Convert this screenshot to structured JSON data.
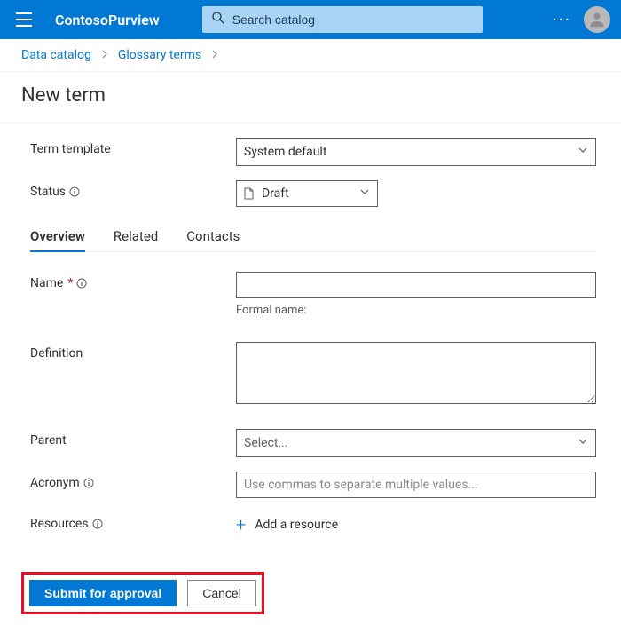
{
  "header": {
    "app_name": "ContosoPurview",
    "search_placeholder": "Search catalog"
  },
  "breadcrumb": {
    "items": [
      {
        "label": "Data catalog"
      },
      {
        "label": "Glossary terms"
      }
    ]
  },
  "page_title": "New term",
  "form": {
    "term_template": {
      "label": "Term template",
      "value": "System default"
    },
    "status": {
      "label": "Status",
      "value": "Draft"
    }
  },
  "tabs": [
    {
      "label": "Overview",
      "active": true
    },
    {
      "label": "Related",
      "active": false
    },
    {
      "label": "Contacts",
      "active": false
    }
  ],
  "fields": {
    "name": {
      "label": "Name",
      "required_mark": "*",
      "value": "",
      "formal_label": "Formal name:"
    },
    "definition": {
      "label": "Definition",
      "value": ""
    },
    "parent": {
      "label": "Parent",
      "placeholder": "Select..."
    },
    "acronym": {
      "label": "Acronym",
      "placeholder": "Use commas to separate multiple values..."
    },
    "resources": {
      "label": "Resources",
      "add_label": "Add a resource"
    }
  },
  "footer": {
    "submit_label": "Submit for approval",
    "cancel_label": "Cancel"
  },
  "colors": {
    "brand": "#0078d4",
    "highlight_border": "#e81123"
  }
}
